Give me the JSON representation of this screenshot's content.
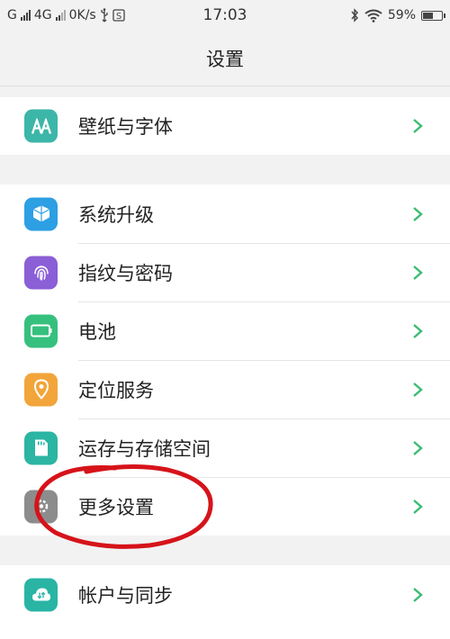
{
  "status_bar": {
    "carrier1": "G",
    "carrier2": "4G",
    "speed": "0K/s",
    "time": "17:03",
    "battery_percent": "59%",
    "battery_level": 0.59
  },
  "header": {
    "title": "设置"
  },
  "groups": [
    {
      "items": [
        {
          "label": "壁纸与字体",
          "icon": "wallpaper-font-icon",
          "icon_color": "#3cb6a8"
        }
      ]
    },
    {
      "items": [
        {
          "label": "系统升级",
          "icon": "system-update-icon",
          "icon_color": "#2d9fe3"
        },
        {
          "label": "指纹与密码",
          "icon": "fingerprint-icon",
          "icon_color": "#8b5fd6"
        },
        {
          "label": "电池",
          "icon": "battery-icon",
          "icon_color": "#36c07e"
        },
        {
          "label": "定位服务",
          "icon": "location-icon",
          "icon_color": "#f2a53a"
        },
        {
          "label": "运存与存储空间",
          "icon": "storage-icon",
          "icon_color": "#2bb5a2"
        },
        {
          "label": "更多设置",
          "icon": "more-settings-icon",
          "icon_color": "#8c8c8c"
        }
      ]
    },
    {
      "items": [
        {
          "label": "帐户与同步",
          "icon": "account-sync-icon",
          "icon_color": "#29b4a4"
        }
      ]
    }
  ],
  "colors": {
    "chevron": "#3dbb72",
    "annotation": "#d6131a"
  }
}
